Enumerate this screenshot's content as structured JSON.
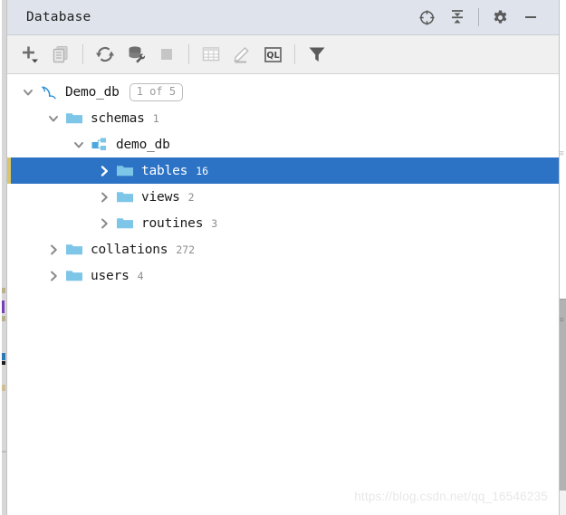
{
  "window": {
    "title": "Database",
    "title_actions": [
      {
        "name": "scroll-from-source-icon",
        "label": "Scroll from Source"
      },
      {
        "name": "collapse-all-icon",
        "label": "Collapse All"
      },
      {
        "name": "settings-gear-icon",
        "label": "Settings"
      },
      {
        "name": "minimize-icon",
        "label": "Hide"
      }
    ]
  },
  "toolbar": {
    "items": [
      {
        "name": "add-new-button",
        "label": "New",
        "icon": "plus-dropdown-icon",
        "enabled": true
      },
      {
        "name": "duplicate-button",
        "label": "Duplicate",
        "icon": "copy-icon",
        "enabled": false
      },
      {
        "name": "refresh-button",
        "label": "Refresh",
        "icon": "refresh-icon",
        "enabled": true
      },
      {
        "name": "modify-datasource-button",
        "label": "Modify Data Source",
        "icon": "database-wrench-icon",
        "enabled": true
      },
      {
        "name": "stop-button",
        "label": "Stop",
        "icon": "stop-square-icon",
        "enabled": false
      },
      {
        "name": "open-table-editor-button",
        "label": "Table Editor",
        "icon": "table-grid-icon",
        "enabled": false
      },
      {
        "name": "edit-button",
        "label": "Edit",
        "icon": "pencil-icon",
        "enabled": false
      },
      {
        "name": "query-console-button",
        "label": "Open Console",
        "icon": "ql-console-icon",
        "enabled": true
      },
      {
        "name": "filter-button",
        "label": "Filter",
        "icon": "funnel-icon",
        "enabled": true
      }
    ]
  },
  "tree": {
    "rows": [
      {
        "name": "tree-node-demo-db-datasource",
        "label": "Demo_db",
        "count": "",
        "badge": "1 of 5",
        "icon": "mysql-dolphin-icon",
        "expanded": true,
        "depth": 0,
        "selected": false
      },
      {
        "name": "tree-node-schemas",
        "label": "schemas",
        "count": "1",
        "badge": "",
        "icon": "folder-icon",
        "expanded": true,
        "depth": 1,
        "selected": false
      },
      {
        "name": "tree-node-demo-db-schema",
        "label": "demo_db",
        "count": "",
        "badge": "",
        "icon": "schema-icon",
        "expanded": true,
        "depth": 2,
        "selected": false
      },
      {
        "name": "tree-node-tables",
        "label": "tables",
        "count": "16",
        "badge": "",
        "icon": "folder-icon",
        "expanded": false,
        "depth": 3,
        "selected": true
      },
      {
        "name": "tree-node-views",
        "label": "views",
        "count": "2",
        "badge": "",
        "icon": "folder-icon",
        "expanded": false,
        "depth": 3,
        "selected": false
      },
      {
        "name": "tree-node-routines",
        "label": "routines",
        "count": "3",
        "badge": "",
        "icon": "folder-icon",
        "expanded": false,
        "depth": 3,
        "selected": false
      },
      {
        "name": "tree-node-collations",
        "label": "collations",
        "count": "272",
        "badge": "",
        "icon": "folder-icon",
        "expanded": false,
        "depth": 1,
        "selected": false
      },
      {
        "name": "tree-node-users",
        "label": "users",
        "count": "4",
        "badge": "",
        "icon": "folder-icon",
        "expanded": false,
        "depth": 1,
        "selected": false
      }
    ]
  },
  "watermark": {
    "text": "https://blog.csdn.net/qq_16546235"
  },
  "colors": {
    "selection": "#2d73c5",
    "folder": "#7ec6e8",
    "titlebar": "#dfe3ec",
    "toolbar": "#f0f0f0",
    "icon_enabled": "#6e6e6e",
    "icon_disabled": "#c4c4c4"
  }
}
